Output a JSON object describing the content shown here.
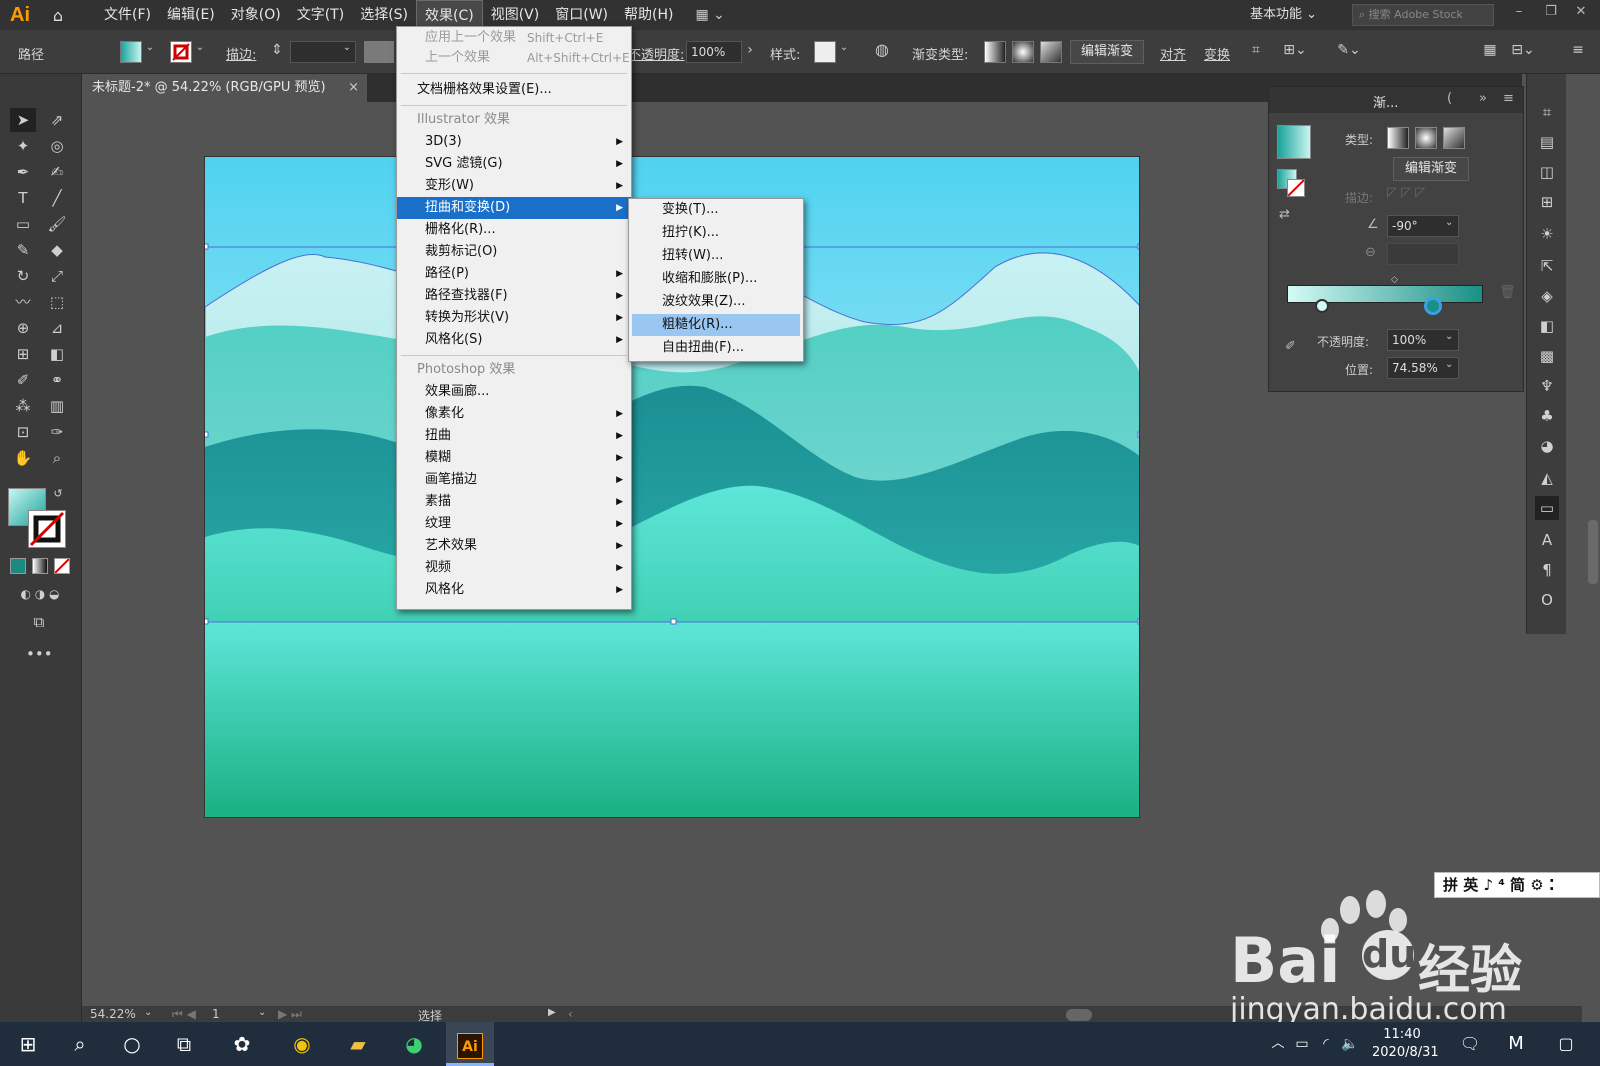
{
  "app": {
    "logo": "Ai",
    "workspace": "基本功能",
    "search_placeholder": "搜索 Adobe Stock"
  },
  "menubar": [
    "文件(F)",
    "编辑(E)",
    "对象(O)",
    "文字(T)",
    "选择(S)",
    "效果(C)",
    "视图(V)",
    "窗口(W)",
    "帮助(H)"
  ],
  "control": {
    "object_type": "路径",
    "stroke_label": "描边:",
    "opacity_label": "不透明度:",
    "opacity_value": "100%",
    "style_label": "样式:",
    "grad_type_label": "渐变类型:",
    "edit_grad": "编辑渐变",
    "align": "对齐",
    "transform": "变换"
  },
  "document_tab": {
    "title": "未标题-2* @ 54.22% (RGB/GPU 预览)",
    "close": "×"
  },
  "effect_menu": {
    "apply_last": "应用上一个效果",
    "apply_last_sc": "Shift+Ctrl+E",
    "last": "上一个效果",
    "last_sc": "Alt+Shift+Ctrl+E",
    "raster_settings": "文档栅格效果设置(E)...",
    "illustrator_header": "Illustrator 效果",
    "illustrator_items": [
      "3D(3)",
      "SVG 滤镜(G)",
      "变形(W)",
      "扭曲和变换(D)",
      "栅格化(R)...",
      "裁剪标记(O)",
      "路径(P)",
      "路径查找器(F)",
      "转换为形状(V)",
      "风格化(S)"
    ],
    "photoshop_header": "Photoshop 效果",
    "photoshop_items": [
      "效果画廊...",
      "像素化",
      "扭曲",
      "模糊",
      "画笔描边",
      "素描",
      "纹理",
      "艺术效果",
      "视频",
      "风格化"
    ]
  },
  "submenu": [
    "变换(T)...",
    "扭拧(K)...",
    "扭转(W)...",
    "收缩和膨胀(P)...",
    "波纹效果(Z)...",
    "粗糙化(R)...",
    "自由扭曲(F)..."
  ],
  "gradient_panel": {
    "tab": "渐...",
    "type_label": "类型:",
    "edit_btn": "编辑渐变",
    "stroke_label": "描边:",
    "angle": "-90°",
    "opacity_label": "不透明度:",
    "opacity_value": "100%",
    "location_label": "位置:",
    "location_value": "74.58%",
    "stop_location": 0.7458
  },
  "statusbar": {
    "zoom": "54.22%",
    "page": "1",
    "tool": "选择"
  },
  "taskbar": {
    "time": "11:40",
    "date": "2020/8/31"
  },
  "ime": "拼 英 ♪ ⁴ 简 ⚙ ⁚",
  "watermark": {
    "brand": "Bai",
    "brand2": "经验",
    "url": "jingyan.baidu.com"
  },
  "colors": {
    "accent": "#1a6fc9",
    "teal_dark": "#1a9a92",
    "teal_light": "#5ee8d8",
    "sky": "#55d6f2"
  }
}
